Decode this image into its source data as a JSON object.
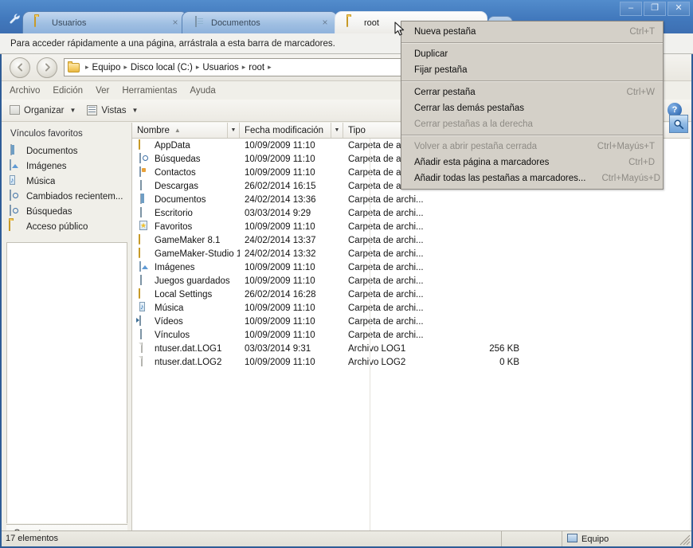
{
  "browser": {
    "wrench_icon": "wrench-icon",
    "tabs": [
      {
        "label": "Usuarios",
        "icon": "folder-icon",
        "close": "×",
        "active": false
      },
      {
        "label": "Documentos",
        "icon": "document-icon",
        "close": "×",
        "active": false
      },
      {
        "label": "root",
        "icon": "folder-icon",
        "close": "",
        "active": true
      }
    ],
    "new_tab_label": "",
    "window_controls": {
      "minimize": "–",
      "maximize": "❐",
      "close": "✕"
    },
    "bookmark_bar_text": "Para acceder rápidamente a una página, arrástrala a esta barra de marcadores."
  },
  "context_menu": {
    "items": [
      {
        "label": "Nueva pestaña",
        "accel": "Ctrl+T",
        "disabled": false,
        "separator_after": true
      },
      {
        "label": "Duplicar",
        "accel": "",
        "disabled": false,
        "separator_after": false
      },
      {
        "label": "Fijar pestaña",
        "accel": "",
        "disabled": false,
        "separator_after": true
      },
      {
        "label": "Cerrar pestaña",
        "accel": "Ctrl+W",
        "disabled": false,
        "separator_after": false
      },
      {
        "label": "Cerrar las demás pestañas",
        "accel": "",
        "disabled": false,
        "separator_after": false
      },
      {
        "label": "Cerrar pestañas a la derecha",
        "accel": "",
        "disabled": true,
        "separator_after": true
      },
      {
        "label": "Volver a abrir pestaña cerrada",
        "accel": "Ctrl+Mayús+T",
        "disabled": true,
        "separator_after": false
      },
      {
        "label": "Añadir esta página a marcadores",
        "accel": "Ctrl+D",
        "disabled": false,
        "separator_after": false
      },
      {
        "label": "Añadir todas las pestañas a marcadores...",
        "accel": "Ctrl+Mayús+D",
        "disabled": false,
        "separator_after": false
      }
    ]
  },
  "explorer": {
    "nav": {
      "back_icon": "back-arrow-icon",
      "forward_icon": "forward-arrow-icon",
      "address_icon": "folder-icon",
      "breadcrumbs": [
        "Equipo",
        "Disco local (C:)",
        "Usuarios",
        "root"
      ],
      "separator": "▸",
      "search_icon": "search-icon"
    },
    "menubar": [
      "Archivo",
      "Edición",
      "Ver",
      "Herramientas",
      "Ayuda"
    ],
    "toolbar": {
      "organize_label": "Organizar",
      "organize_icon": "stack-icon",
      "views_label": "Vistas",
      "views_icon": "views-icon",
      "caret": "▼",
      "help_label": "?"
    },
    "sidebar": {
      "header": "Vínculos favoritos",
      "items": [
        {
          "label": "Documentos",
          "icon": "document-icon"
        },
        {
          "label": "Imágenes",
          "icon": "picture-icon"
        },
        {
          "label": "Música",
          "icon": "music-icon"
        },
        {
          "label": "Cambiados recientem...",
          "icon": "search-icon"
        },
        {
          "label": "Búsquedas",
          "icon": "search-icon"
        },
        {
          "label": "Acceso público",
          "icon": "folder-icon"
        }
      ],
      "folders_label": "Carpetas",
      "folders_chevron": "∧"
    },
    "columns": [
      {
        "label": "Nombre",
        "sort": "▲"
      },
      {
        "label": "Fecha modificación",
        "sort": ""
      },
      {
        "label": "Tipo",
        "sort": ""
      },
      {
        "label": "",
        "sort": ""
      }
    ],
    "column_dropdown": "▼",
    "files": [
      {
        "name": "AppData",
        "date": "10/09/2009 11:10",
        "type": "Carpeta de arc",
        "size": "",
        "icon": "folder-icon"
      },
      {
        "name": "Búsquedas",
        "date": "10/09/2009 11:10",
        "type": "Carpeta de arc",
        "size": "",
        "icon": "search-folder-icon"
      },
      {
        "name": "Contactos",
        "date": "10/09/2009 11:10",
        "type": "Carpeta de arc",
        "size": "",
        "icon": "contacts-icon"
      },
      {
        "name": "Descargas",
        "date": "26/02/2014 16:15",
        "type": "Carpeta de arc",
        "size": "",
        "icon": "drawer-icon"
      },
      {
        "name": "Documentos",
        "date": "24/02/2014 13:36",
        "type": "Carpeta de archi...",
        "size": "",
        "icon": "document-icon"
      },
      {
        "name": "Escritorio",
        "date": "03/03/2014 9:29",
        "type": "Carpeta de archi...",
        "size": "",
        "icon": "drawer-icon"
      },
      {
        "name": "Favoritos",
        "date": "10/09/2009 11:10",
        "type": "Carpeta de archi...",
        "size": "",
        "icon": "star-icon"
      },
      {
        "name": "GameMaker 8.1",
        "date": "24/02/2014 13:37",
        "type": "Carpeta de archi...",
        "size": "",
        "icon": "folder-icon"
      },
      {
        "name": "GameMaker-Studio 1.2",
        "date": "24/02/2014 13:32",
        "type": "Carpeta de archi...",
        "size": "",
        "icon": "folder-icon"
      },
      {
        "name": "Imágenes",
        "date": "10/09/2009 11:10",
        "type": "Carpeta de archi...",
        "size": "",
        "icon": "picture-icon"
      },
      {
        "name": "Juegos guardados",
        "date": "10/09/2009 11:10",
        "type": "Carpeta de archi...",
        "size": "",
        "icon": "drawer-icon"
      },
      {
        "name": "Local Settings",
        "date": "26/02/2014 16:28",
        "type": "Carpeta de archi...",
        "size": "",
        "icon": "folder-icon"
      },
      {
        "name": "Música",
        "date": "10/09/2009 11:10",
        "type": "Carpeta de archi...",
        "size": "",
        "icon": "music-icon"
      },
      {
        "name": "Vídeos",
        "date": "10/09/2009 11:10",
        "type": "Carpeta de archi...",
        "size": "",
        "icon": "video-icon"
      },
      {
        "name": "Vínculos",
        "date": "10/09/2009 11:10",
        "type": "Carpeta de archi...",
        "size": "",
        "icon": "drawer-icon"
      },
      {
        "name": "ntuser.dat.LOG1",
        "date": "03/03/2014 9:31",
        "type": "Archivo LOG1",
        "size": "256 KB",
        "icon": "file-icon"
      },
      {
        "name": "ntuser.dat.LOG2",
        "date": "10/09/2009 11:10",
        "type": "Archivo LOG2",
        "size": "0 KB",
        "icon": "file-icon"
      }
    ],
    "statusbar": {
      "items_text": "17 elementos",
      "middle": "",
      "computer_label": "Equipo",
      "computer_icon": "computer-icon"
    }
  },
  "colors": {
    "titlebar_blue": "#4279bd",
    "window_border": "#2e5c96",
    "menu_bg": "#d4d0c8",
    "chrome_bg": "#f0efe9",
    "list_bg": "#ffffff",
    "disabled_text": "#8e8b85"
  }
}
